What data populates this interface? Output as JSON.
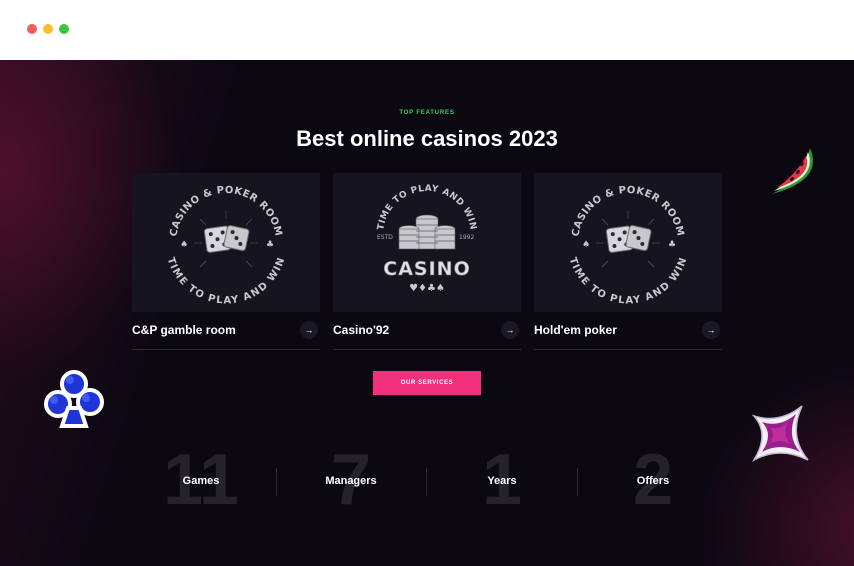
{
  "window": {
    "controls": [
      "close",
      "minimize",
      "maximize"
    ]
  },
  "section": {
    "eyebrow": "TOP FEATURES",
    "title": "Best online casinos 2023"
  },
  "cards": [
    {
      "title": "C&P gamble room",
      "badge_top": "CASINO & POKER ROOM",
      "badge_bottom": "TIME TO PLAY AND WIN",
      "icon": "dice-icon"
    },
    {
      "title": "Casino'92",
      "badge_top": "TIME TO PLAY AND WIN",
      "badge_main": "CASINO",
      "badge_left": "ESTD",
      "badge_right": "1992",
      "icon": "chips-icon"
    },
    {
      "title": "Hold'em poker",
      "badge_top": "CASINO & POKER ROOM",
      "badge_bottom": "TIME TO PLAY AND WIN",
      "icon": "dice-icon"
    }
  ],
  "cta": {
    "label": "OUR SERVICES"
  },
  "stats": [
    {
      "number": "11",
      "label": "Games"
    },
    {
      "number": "7",
      "label": "Managers"
    },
    {
      "number": "1",
      "label": "Years"
    },
    {
      "number": "2",
      "label": "Offers"
    }
  ],
  "colors": {
    "accent": "#f0307c",
    "eyebrow": "#3fd05a",
    "background": "#0b0812",
    "card": "#16141f"
  },
  "decorations": [
    "watermelon-icon",
    "club-icon",
    "diamond-icon"
  ]
}
